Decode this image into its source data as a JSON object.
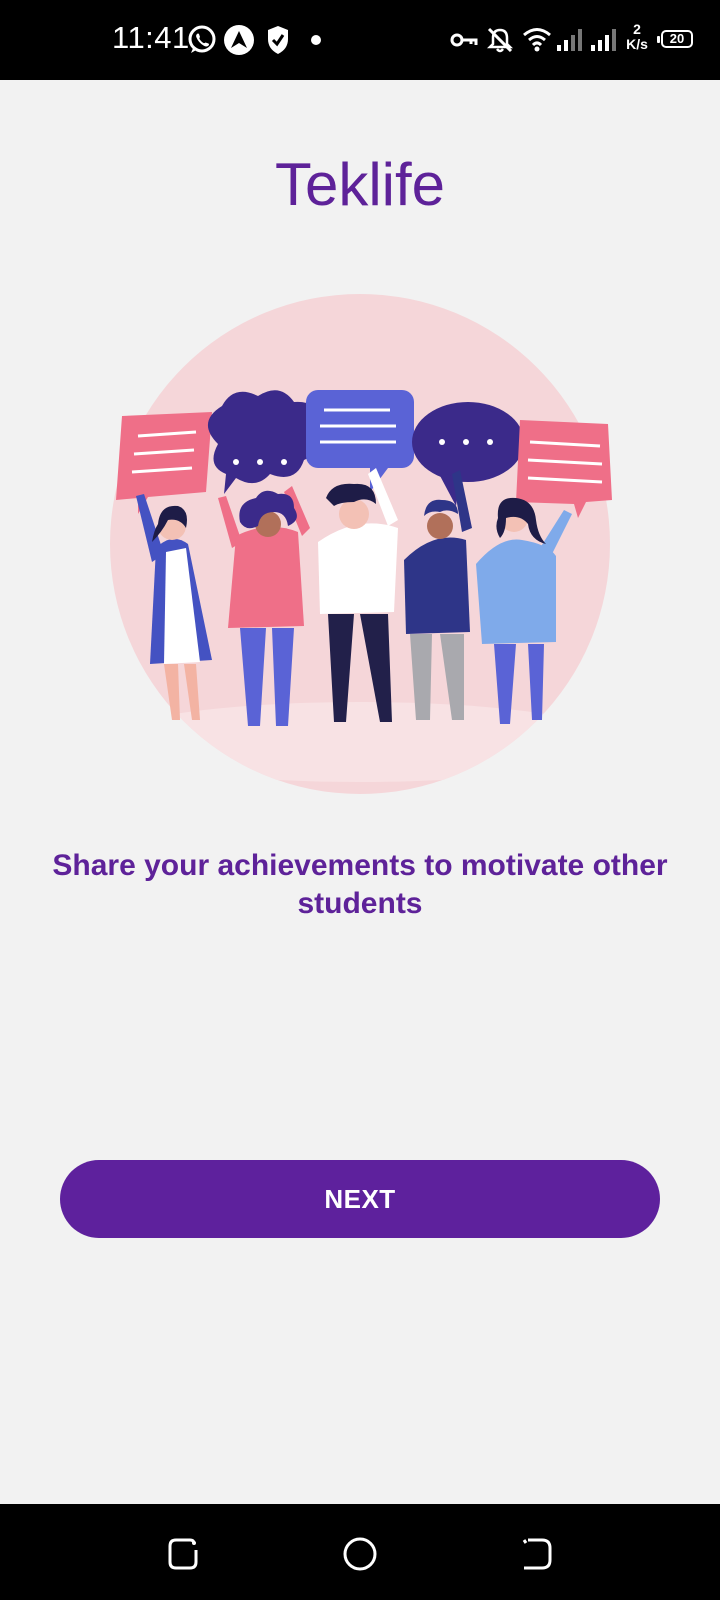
{
  "status_bar": {
    "time": "11:41",
    "netspeed_value": "2",
    "netspeed_unit": "K/s",
    "battery": "20",
    "icons": [
      "whatsapp-icon",
      "nav-arrow-icon",
      "shield-icon",
      "dot-icon",
      "vpn-key-icon",
      "bell-off-icon",
      "wifi-icon",
      "signal-icon",
      "signal-icon"
    ]
  },
  "app": {
    "title": "Teklife",
    "caption": "Share your achievements to motivate other students",
    "next_label": "NEXT"
  },
  "illustration": {
    "subject": "people-with-speech-bubbles"
  },
  "nav_bar": {
    "buttons": [
      "recent-apps-icon",
      "home-icon",
      "back-icon"
    ]
  },
  "colors": {
    "primary": "#5e2299",
    "button": "#5e219d",
    "background": "#f2f2f2",
    "circle": "#f5d6d9"
  }
}
